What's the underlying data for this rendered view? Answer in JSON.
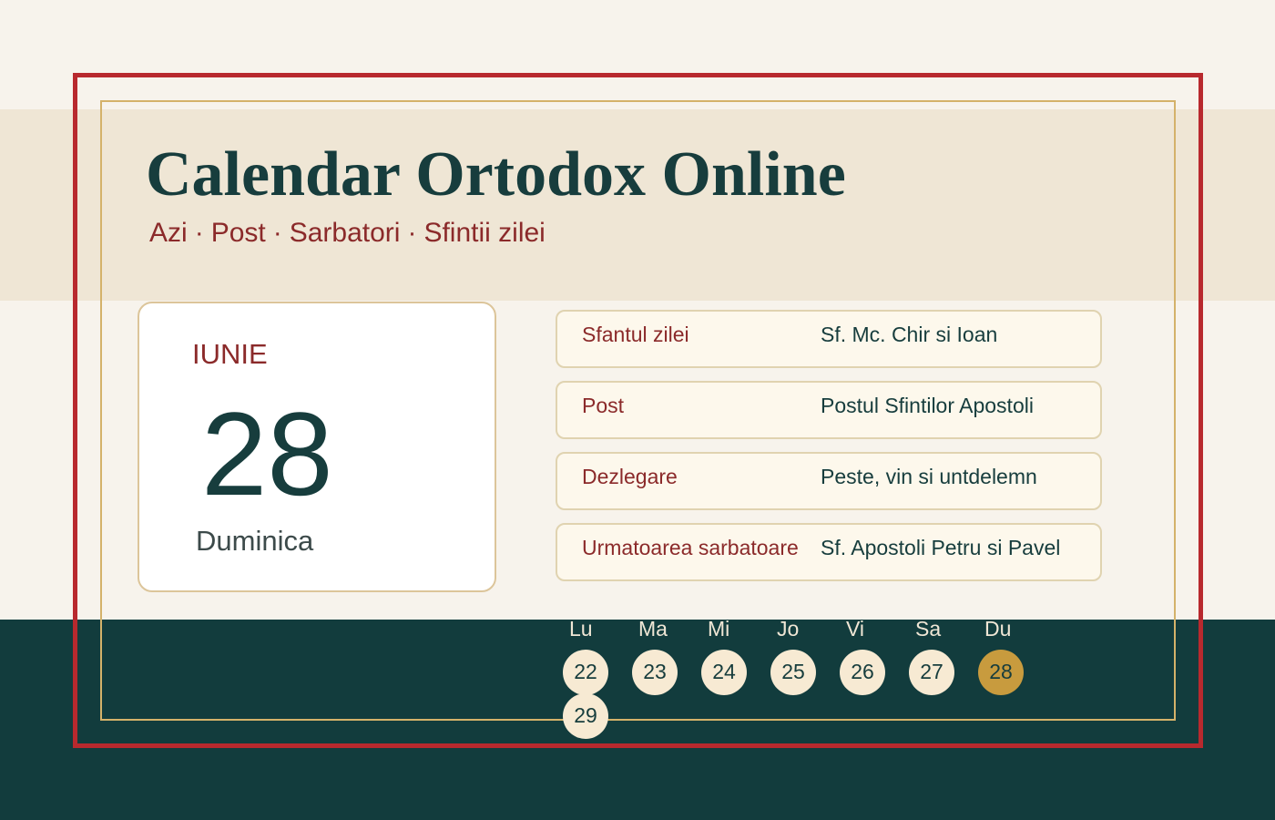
{
  "site": {
    "title": "Calendar Ortodox Online"
  },
  "nav": {
    "items": [
      "Azi",
      "Post",
      "Sarbatori",
      "Sfintii zilei"
    ],
    "separator": "·"
  },
  "today": {
    "month": "IUNIE",
    "day": "28",
    "weekday": "Duminica"
  },
  "info": [
    {
      "label": "Sfantul zilei",
      "value": "Sf. Mc. Chir si Ioan"
    },
    {
      "label": "Post",
      "value": "Postul Sfintilor Apostoli"
    },
    {
      "label": "Dezlegare",
      "value": "Peste, vin si untdelemn"
    },
    {
      "label": "Urmatoarea sarbatoare",
      "value": "Sf. Apostoli Petru si Pavel"
    }
  ],
  "week": {
    "headers": [
      "Lu",
      "Ma",
      "Mi",
      "Jo",
      "Vi",
      "Sa",
      "Du"
    ],
    "days": [
      "22",
      "23",
      "24",
      "25",
      "26",
      "27",
      "28",
      "29"
    ],
    "selected": "28"
  },
  "colors": {
    "accent_red": "#b8292e",
    "gold": "#d4b26a",
    "dark_teal": "#123c3d",
    "today_highlight": "#c89b3e"
  }
}
